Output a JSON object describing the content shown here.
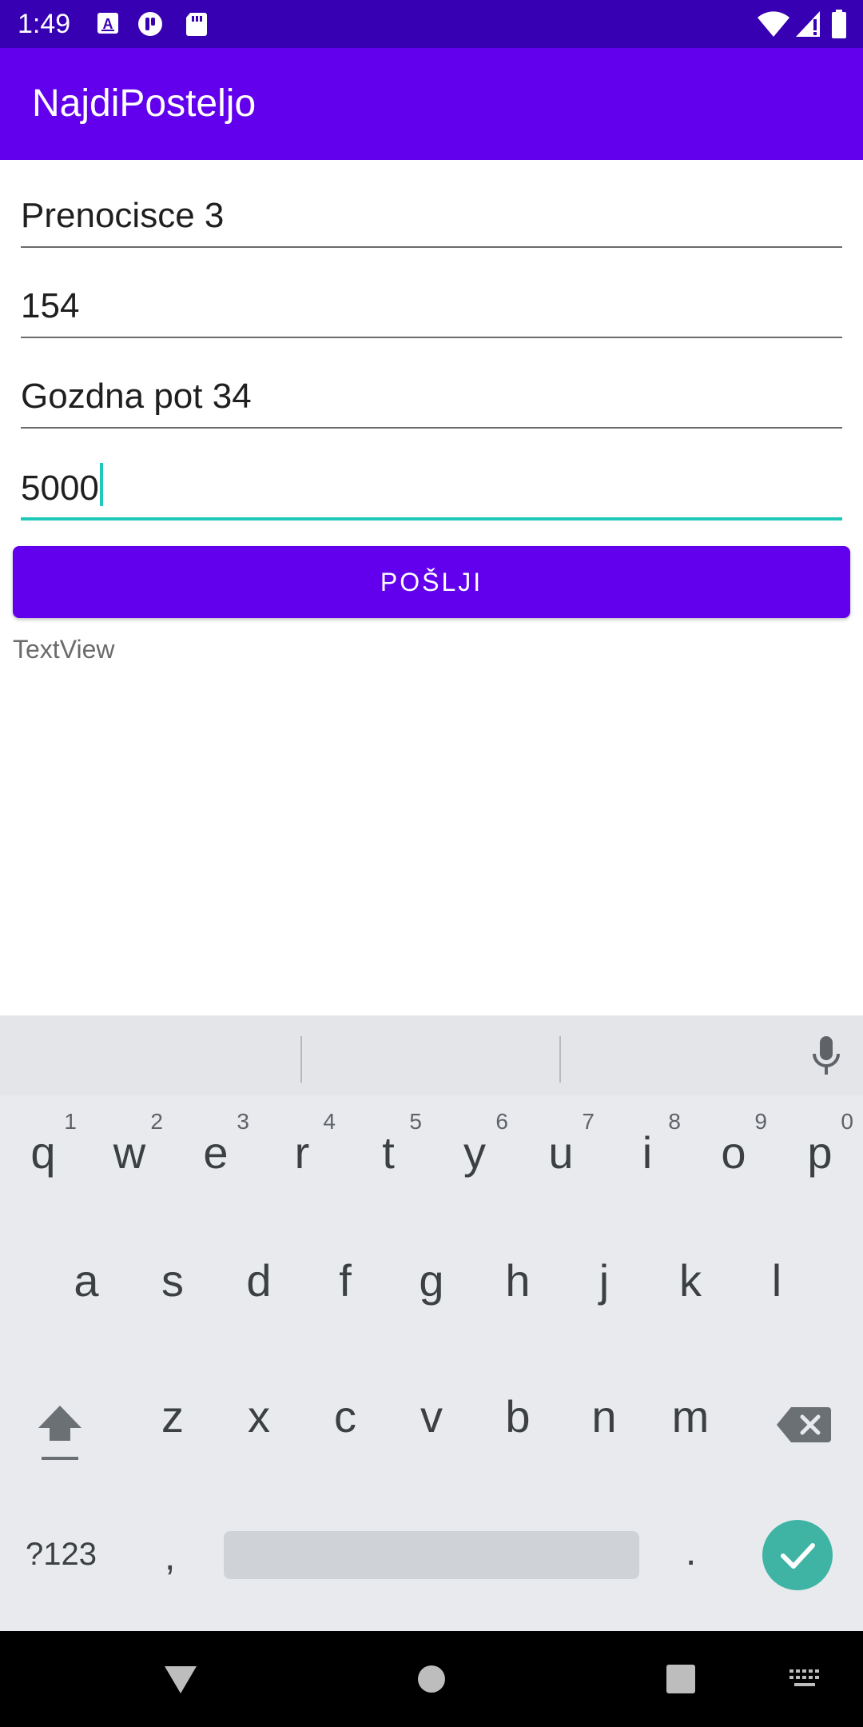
{
  "status_bar": {
    "time": "1:49",
    "left_icons": [
      "a-box-icon",
      "pause-circle-icon",
      "sd-card-icon"
    ],
    "right_icons": [
      "wifi-icon",
      "signal-icon",
      "battery-icon"
    ]
  },
  "app_bar": {
    "title": "NajdiPosteljo"
  },
  "form": {
    "field_1_value": "Prenocisce 3",
    "field_2_value": "154",
    "field_3_value": "Gozdna pot 34",
    "field_4_value": "5000",
    "send_label": "POŠLJI",
    "result_text": "TextView"
  },
  "keyboard": {
    "row1": [
      {
        "letter": "q",
        "hint": "1"
      },
      {
        "letter": "w",
        "hint": "2"
      },
      {
        "letter": "e",
        "hint": "3"
      },
      {
        "letter": "r",
        "hint": "4"
      },
      {
        "letter": "t",
        "hint": "5"
      },
      {
        "letter": "y",
        "hint": "6"
      },
      {
        "letter": "u",
        "hint": "7"
      },
      {
        "letter": "i",
        "hint": "8"
      },
      {
        "letter": "o",
        "hint": "9"
      },
      {
        "letter": "p",
        "hint": "0"
      }
    ],
    "row2": [
      "a",
      "s",
      "d",
      "f",
      "g",
      "h",
      "j",
      "k",
      "l"
    ],
    "row3": [
      "z",
      "x",
      "c",
      "v",
      "b",
      "n",
      "m"
    ],
    "symbols_label": "?123",
    "comma_label": ",",
    "period_label": "."
  },
  "colors": {
    "status_bar": "#3700b3",
    "primary": "#6200ee",
    "accent": "#1fc8b8",
    "enter_key": "#3fb4a4"
  }
}
